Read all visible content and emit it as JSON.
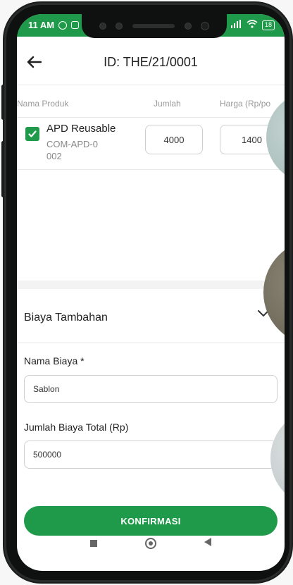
{
  "status_bar": {
    "time": "11 AM",
    "battery": "18"
  },
  "header": {
    "title": "ID: THE/21/0001"
  },
  "table": {
    "columns": [
      "Nama Produk",
      "Jumlah",
      "Harga (Rp/po"
    ],
    "rows": [
      {
        "name": "APD Reusable",
        "code": "COM-APD-0 002",
        "qty": "4000",
        "price": "1400",
        "checked": true
      }
    ]
  },
  "extra": {
    "section_title": "Biaya Tambahan",
    "name_label": "Nama Biaya *",
    "name_value": "Sablon",
    "total_label": "Jumlah Biaya Total (Rp)",
    "total_value": "500000"
  },
  "confirm_button": "KONFIRMASI",
  "colors": {
    "primary": "#1f9a4a"
  },
  "icons": [
    "back-arrow-icon",
    "check-icon",
    "chevron-down-icon",
    "square-nav-icon",
    "circle-nav-icon",
    "triangle-back-nav-icon"
  ]
}
